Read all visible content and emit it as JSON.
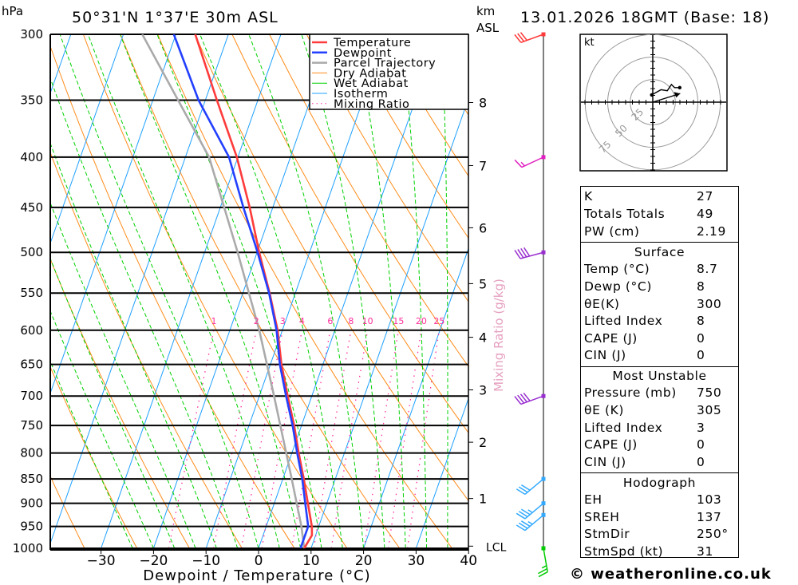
{
  "header": {
    "location": "50°31'N 1°37'E 30m ASL",
    "datetime": "13.01.2026 18GMT (Base: 18)",
    "pressure_unit": "hPa",
    "height_unit_line1": "km",
    "height_unit_line2": "ASL"
  },
  "legend": [
    {
      "label": "Temperature",
      "color": "#ff3b3b",
      "style": "thick"
    },
    {
      "label": "Dewpoint",
      "color": "#2340ff",
      "style": "thick"
    },
    {
      "label": "Parcel Trajectory",
      "color": "#aaaaaa",
      "style": "thick"
    },
    {
      "label": "Dry Adiabat",
      "color": "#ff8c1a",
      "style": "thin"
    },
    {
      "label": "Wet Adiabat",
      "color": "#00d000",
      "style": "thin"
    },
    {
      "label": "Isotherm",
      "color": "#1ea0ff",
      "style": "thin"
    },
    {
      "label": "Mixing Ratio",
      "color": "#ff2d9b",
      "style": "dotted"
    }
  ],
  "chart_data": {
    "type": "line",
    "subtype": "skew-T log-p",
    "xlabel": "Dewpoint / Temperature (°C)",
    "ylabel": "hPa",
    "xlim": [
      -40,
      40
    ],
    "ylim_hpa": [
      1000,
      300
    ],
    "y_scale": "log",
    "x_ticks": [
      -30,
      -20,
      -10,
      0,
      10,
      20,
      30,
      40
    ],
    "pressure_ticks": [
      300,
      350,
      400,
      450,
      500,
      550,
      600,
      650,
      700,
      750,
      800,
      850,
      900,
      950,
      1000
    ],
    "km_ticks": [
      {
        "label": "8",
        "p": 352
      },
      {
        "label": "7",
        "p": 408
      },
      {
        "label": "6",
        "p": 472
      },
      {
        "label": "5",
        "p": 538
      },
      {
        "label": "4",
        "p": 610
      },
      {
        "label": "3",
        "p": 690
      },
      {
        "label": "2",
        "p": 780
      },
      {
        "label": "1",
        "p": 890
      },
      {
        "label": "LCL",
        "p": 995
      }
    ],
    "mixing_ratio_title": "Mixing Ratio (g/kg)",
    "mixing_ratio_labels": [
      1,
      2,
      3,
      4,
      6,
      8,
      10,
      15,
      20,
      25
    ],
    "series": [
      {
        "name": "Temperature",
        "color": "#ff3b3b",
        "p": [
          1000,
          970,
          950,
          900,
          850,
          800,
          750,
          700,
          650,
          600,
          550,
          500,
          450,
          400,
          350,
          300
        ],
        "t": [
          8.7,
          9.3,
          8.7,
          6.4,
          4.0,
          1.3,
          -1.4,
          -4.6,
          -7.9,
          -10.9,
          -14.9,
          -19.6,
          -24.4,
          -30.2,
          -37.8,
          -46.3
        ]
      },
      {
        "name": "Dewpoint",
        "color": "#2340ff",
        "p": [
          1000,
          970,
          950,
          900,
          850,
          800,
          750,
          700,
          650,
          600,
          550,
          500,
          450,
          400,
          350,
          300
        ],
        "t": [
          8.0,
          8.0,
          8.0,
          5.9,
          3.7,
          1.0,
          -1.7,
          -4.9,
          -8.2,
          -11.1,
          -15.0,
          -19.9,
          -25.6,
          -31.7,
          -41.3,
          -50.4
        ]
      },
      {
        "name": "Parcel Trajectory",
        "color": "#aaaaaa",
        "p": [
          1000,
          950,
          850,
          700,
          600,
          500,
          400,
          300
        ],
        "t": [
          8.7,
          6.7,
          1.7,
          -7.2,
          -14.4,
          -23.7,
          -35.5,
          -56.4
        ]
      }
    ],
    "wind_barbs": [
      {
        "p": 300,
        "dir": 250,
        "kt": 30,
        "color": "#ff3b3b"
      },
      {
        "p": 400,
        "dir": 245,
        "kt": 15,
        "color": "#e020c0"
      },
      {
        "p": 500,
        "dir": 255,
        "kt": 40,
        "color": "#9a2fd0"
      },
      {
        "p": 700,
        "dir": 250,
        "kt": 40,
        "color": "#9a2fd0"
      },
      {
        "p": 850,
        "dir": 230,
        "kt": 30,
        "color": "#33aaff"
      },
      {
        "p": 900,
        "dir": 230,
        "kt": 35,
        "color": "#33aaff"
      },
      {
        "p": 925,
        "dir": 230,
        "kt": 35,
        "color": "#33aaff"
      },
      {
        "p": 1000,
        "dir": 170,
        "kt": 25,
        "color": "#00cc00"
      }
    ],
    "hodograph": {
      "unit": "kt",
      "rings": [
        25,
        50,
        75
      ],
      "trace_uv_kt": [
        [
          -1,
          7
        ],
        [
          8,
          12
        ],
        [
          14,
          11
        ],
        [
          18,
          17
        ],
        [
          21,
          14
        ],
        [
          26,
          14
        ]
      ],
      "storm_motion_uv_kt": [
        16,
        5
      ]
    }
  },
  "indices": {
    "general": [
      {
        "label": "K",
        "value": "27"
      },
      {
        "label": "Totals Totals",
        "value": "49"
      },
      {
        "label": "PW (cm)",
        "value": "2.19"
      }
    ],
    "surface": {
      "title": "Surface",
      "rows": [
        {
          "label": "Temp (°C)",
          "value": "8.7"
        },
        {
          "label": "Dewp (°C)",
          "value": "8"
        },
        {
          "label": "θE(K)",
          "value": "300"
        },
        {
          "label": "Lifted Index",
          "value": "8"
        },
        {
          "label": "CAPE (J)",
          "value": "0"
        },
        {
          "label": "CIN (J)",
          "value": "0"
        }
      ]
    },
    "most_unstable": {
      "title": "Most Unstable",
      "rows": [
        {
          "label": "Pressure (mb)",
          "value": "750"
        },
        {
          "label": "θE (K)",
          "value": "305"
        },
        {
          "label": "Lifted Index",
          "value": "3"
        },
        {
          "label": "CAPE (J)",
          "value": "0"
        },
        {
          "label": "CIN (J)",
          "value": "0"
        }
      ]
    },
    "hodograph": {
      "title": "Hodograph",
      "rows": [
        {
          "label": "EH",
          "value": "103"
        },
        {
          "label": "SREH",
          "value": "137"
        },
        {
          "label": "StmDir",
          "value": "250°"
        },
        {
          "label": "StmSpd (kt)",
          "value": "31"
        }
      ]
    }
  },
  "footer": {
    "copyright": "© weatheronline.co.uk"
  }
}
